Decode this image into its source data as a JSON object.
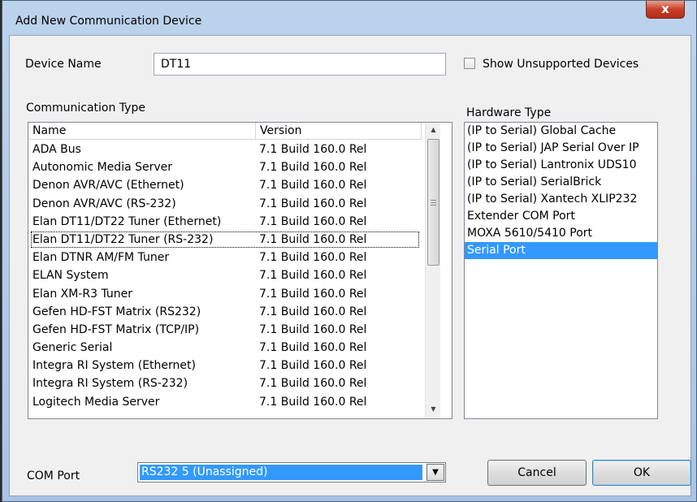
{
  "window": {
    "title": "Add New Communication Device",
    "close_glyph": "x"
  },
  "device_name": {
    "label": "Device Name",
    "value": "DT11"
  },
  "show_unsupported": {
    "label": "Show Unsupported Devices",
    "checked": false
  },
  "communication_type": {
    "label": "Communication Type",
    "columns": [
      "Name",
      "Version"
    ],
    "rows": [
      {
        "name": "ADA Bus",
        "version": "7.1 Build 160.0 Rel"
      },
      {
        "name": "Autonomic Media Server",
        "version": "7.1 Build 160.0 Rel"
      },
      {
        "name": "Denon AVR/AVC (Ethernet)",
        "version": "7.1 Build 160.0 Rel"
      },
      {
        "name": "Denon AVR/AVC (RS-232)",
        "version": "7.1 Build 160.0 Rel"
      },
      {
        "name": "Elan DT11/DT22 Tuner (Ethernet)",
        "version": "7.1 Build 160.0 Rel"
      },
      {
        "name": "Elan DT11/DT22 Tuner (RS-232)",
        "version": "7.1 Build 160.0 Rel"
      },
      {
        "name": "Elan DTNR AM/FM Tuner",
        "version": "7.1 Build 160.0 Rel"
      },
      {
        "name": "ELAN System",
        "version": "7.1 Build 160.0 Rel"
      },
      {
        "name": "Elan XM-R3 Tuner",
        "version": "7.1 Build 160.0 Rel"
      },
      {
        "name": "Gefen HD-FST Matrix (RS232)",
        "version": "7.1 Build 160.0 Rel"
      },
      {
        "name": "Gefen HD-FST Matrix (TCP/IP)",
        "version": "7.1 Build 160.0 Rel"
      },
      {
        "name": "Generic Serial",
        "version": "7.1 Build 160.0 Rel"
      },
      {
        "name": "Integra RI System (Ethernet)",
        "version": "7.1 Build 160.0 Rel"
      },
      {
        "name": "Integra RI System (RS-232)",
        "version": "7.1 Build 160.0 Rel"
      },
      {
        "name": "Logitech Media Server",
        "version": "7.1 Build 160.0 Rel"
      }
    ],
    "focused_row": 5
  },
  "hardware_type": {
    "label": "Hardware Type",
    "items": [
      "(IP to Serial) Global Cache",
      "(IP to Serial) JAP Serial Over IP",
      "(IP to Serial) Lantronix UDS10",
      "(IP to Serial) SerialBrick",
      "(IP to Serial) Xantech XLIP232",
      "Extender COM Port",
      "MOXA 5610/5410 Port",
      "Serial Port"
    ],
    "selected_index": 7
  },
  "com_port": {
    "label": "COM Port",
    "value": "RS232 5 (Unassigned)"
  },
  "buttons": {
    "cancel": "Cancel",
    "ok": "OK"
  },
  "colors": {
    "selection": "#3399ff",
    "title_bar": "#bcd3ec",
    "close_button": "#c7402a"
  },
  "icons": {
    "dropdown": "chevron-down-icon",
    "scroll_up": "arrow-up-icon",
    "scroll_down": "arrow-down-icon"
  }
}
